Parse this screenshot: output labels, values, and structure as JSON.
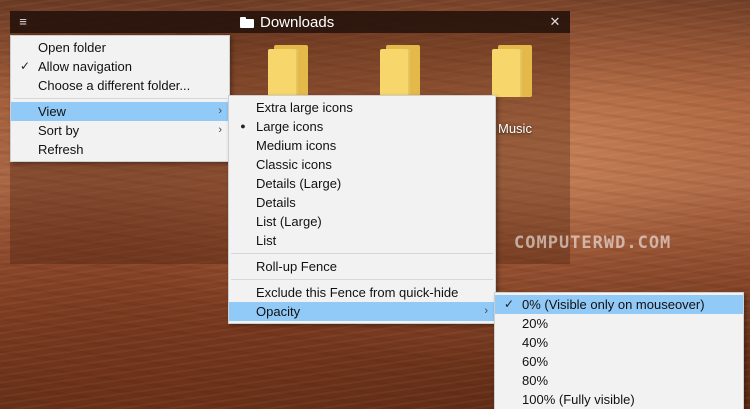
{
  "fence": {
    "title": "Downloads",
    "folders": [
      {
        "label": ""
      },
      {
        "label": ""
      },
      {
        "label": "Music"
      }
    ]
  },
  "menu_main": {
    "items": [
      {
        "label": "Open folder",
        "checked": false
      },
      {
        "label": "Allow navigation",
        "checked": true
      },
      {
        "label": "Choose a different folder...",
        "checked": false
      },
      {
        "label": "View",
        "submenu": true,
        "highlighted": true
      },
      {
        "label": "Sort by",
        "submenu": true
      },
      {
        "label": "Refresh"
      }
    ]
  },
  "menu_view": {
    "items": [
      {
        "label": "Extra large icons"
      },
      {
        "label": "Large icons",
        "selected": true
      },
      {
        "label": "Medium icons"
      },
      {
        "label": "Classic icons"
      },
      {
        "label": "Details (Large)"
      },
      {
        "label": "Details"
      },
      {
        "label": "List (Large)"
      },
      {
        "label": "List"
      },
      {
        "label": "Roll-up Fence"
      },
      {
        "label": "Exclude this Fence from quick-hide"
      },
      {
        "label": "Opacity",
        "submenu": true,
        "highlighted": true
      }
    ]
  },
  "menu_opacity": {
    "items": [
      {
        "label": "0% (Visible only on mouseover)",
        "checked": true,
        "highlighted": true
      },
      {
        "label": "20%"
      },
      {
        "label": "40%"
      },
      {
        "label": "60%"
      },
      {
        "label": "80%"
      },
      {
        "label": "100% (Fully visible)"
      }
    ]
  },
  "glyphs": {
    "hamburger": "≡",
    "close": "✕",
    "check": "✓",
    "bullet": "●",
    "arrow": "›"
  },
  "watermark": "COMPUTERWD.COM",
  "colors": {
    "highlight": "#91c9f7",
    "menu_bg": "#f2f2f2",
    "folder": "#f7d66b"
  }
}
